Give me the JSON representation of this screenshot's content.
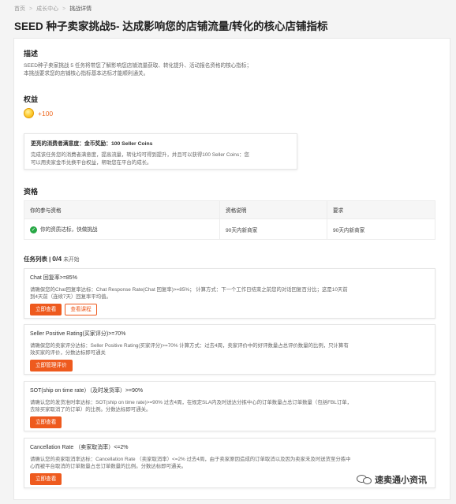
{
  "breadcrumb": {
    "items": [
      "首页",
      "成长中心",
      "挑战详情"
    ],
    "sep": ">"
  },
  "title": "SEED 种子卖家挑战5- 达成影响您的店铺流量/转化的核心店铺指标",
  "description": {
    "heading": "描述",
    "lines": [
      "SEED种子卖家挑战 5 任务将带您了解影响您店铺流量获取、转化提升、活动报名资格的核心指标；",
      "本挑战要求您的店铺核心指标基本达标才能顺利通关。"
    ]
  },
  "benefits": {
    "heading": "权益",
    "coin_value": "+100",
    "box_title": "更亮的消费者满意度：金币奖励：100 Seller Coins",
    "box_lines": [
      "完成该任务您的消费者满意度，提高流量，转化均可得到提升，并且可以获得100 Seller Coins：您",
      "可以用卖家金币兑换平台权益，帮助您在平台的成长。"
    ]
  },
  "qualification": {
    "heading": "资格",
    "columns": [
      "你的参与资格",
      "资格说明",
      "要求"
    ],
    "row": {
      "eligibility": "你的资质达标，快做挑战",
      "explanation": "90天内新商家",
      "requirement": "90天内新商家"
    }
  },
  "tasks": {
    "label": "任务列表",
    "progress": "0/4",
    "status": "未开始",
    "items": [
      {
        "title": "Chat 回复率>=85%",
        "desc": [
          "请确保您的Chat回复率达标：Chat Response Rate(Chat 回复率)>=85%； 计算方式：下一个工作日结束之前您的对话回复百分比；这是10天前",
          "到4天前（连续7天）回复率平均值。"
        ],
        "buttons": [
          {
            "label": "立即查看",
            "style": "primary"
          },
          {
            "label": "查看课程",
            "style": "outline"
          }
        ]
      },
      {
        "title": "Seller Positive Rating(买家评分)>=70%",
        "desc": [
          "请确保您的卖家评分达标：Seller Positive Rating(买家评分)>=70% 计算方式：过去4周，卖家评价中的好评数量占总评价数量的比例，只计算有",
          "效买家的评价，分数达标即可通关"
        ],
        "buttons": [
          {
            "label": "立即管理评价",
            "style": "primary"
          }
        ]
      },
      {
        "title": "SOT(ship on time rate）（及时发货率）>=90%",
        "desc": [
          "请确认您的发货准时率达标：SOT(ship on time rate)>=90% 过去4周，在规定SLA内及时送达分拣中心的订单数量占总订单数量（包括FBL订单，",
          "去除买家取消了的订单）的比例。分数达标即可通关。"
        ],
        "buttons": [
          {
            "label": "立即查看",
            "style": "primary"
          }
        ]
      },
      {
        "title": "Cancellation Rate （卖家取消率）<=2%",
        "desc": [
          "请确认您的卖家取消率达标：Cancellation Rate （卖家取消率）<=2% 过去4周，由于卖家原因造成的订单取消以及因为卖家未及时送货至分拣中",
          "心而被平台取消的订单数量占总订单数量的比例。分数达标即可通关。"
        ],
        "buttons": [
          {
            "label": "立即查看",
            "style": "primary"
          }
        ]
      }
    ]
  },
  "watermark": {
    "text": "速卖通小资讯"
  },
  "colors": {
    "accent": "#ee5a1e",
    "success": "#27a845",
    "coin": "#ee6a22"
  }
}
